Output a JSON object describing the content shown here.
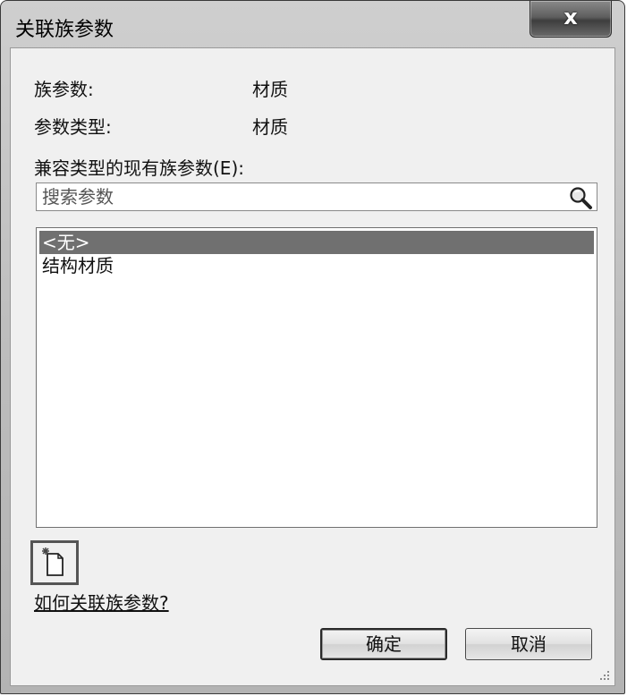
{
  "window": {
    "title": "关联族参数",
    "close_label": "x"
  },
  "fields": {
    "family_param_label": "族参数:",
    "family_param_value": "材质",
    "param_type_label": "参数类型:",
    "param_type_value": "材质",
    "compatible_label": "兼容类型的现有族参数(E):"
  },
  "search": {
    "placeholder": "搜索参数"
  },
  "list": {
    "items": [
      "<无>",
      "结构材质"
    ],
    "selected_index": 0
  },
  "icons": {
    "search": "magnifier-icon",
    "new_parameter": "new-parameter-icon"
  },
  "help": {
    "link_text": "如何关联族参数?"
  },
  "buttons": {
    "ok_label": "确定",
    "cancel_label": "取消"
  }
}
